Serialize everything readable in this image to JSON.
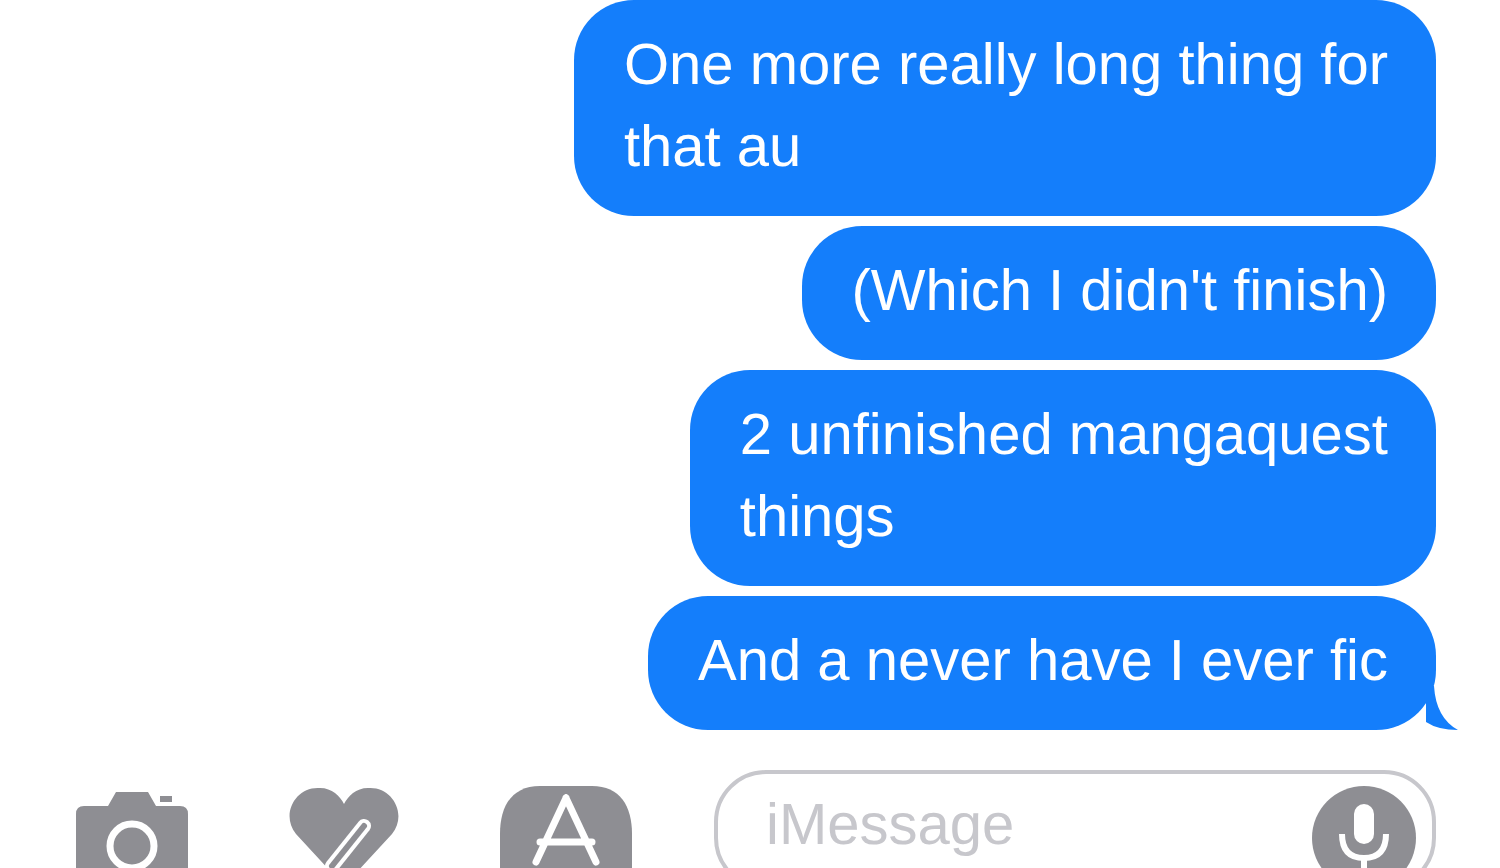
{
  "messages": [
    {
      "lines": [
        "One more really long thing for",
        "that au"
      ],
      "tail": false
    },
    {
      "lines": [
        "(Which I didn't finish)"
      ],
      "tail": false
    },
    {
      "lines": [
        "2 unfinished mangaquest",
        "things"
      ],
      "tail": false
    },
    {
      "lines": [
        "And a never have I ever fic"
      ],
      "tail": true
    }
  ],
  "input": {
    "placeholder": "iMessage"
  }
}
